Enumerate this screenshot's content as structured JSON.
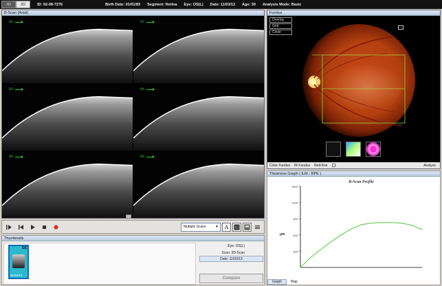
{
  "topbar": {
    "view_tabs": [
      "3D",
      "2D"
    ],
    "id": "ID: 92-08-7276",
    "birth_date": "Birth Date: 01/01/83",
    "segment": "Segment: Retina",
    "eye": "Eye: OS(L)",
    "date": "Date: 11/03/13",
    "age": "Age: 30",
    "analysis_mode": "Analysis Mode: Basic"
  },
  "bscan": {
    "title": "B-Scan (Axial)",
    "labels": [
      "01",
      "02",
      "03",
      "04",
      "05",
      "06"
    ],
    "controls": {
      "view_mode": "Multiple Scans",
      "font_button": "A"
    }
  },
  "thumbnails": {
    "title": "Thumbnails",
    "items": [
      {
        "label": "OS",
        "date": "11/03/13"
      }
    ],
    "info": {
      "eye": "Eye: OS(L)",
      "scan": "Scan: 3D-Scan",
      "date": "Date: 11/03/13"
    },
    "compare_label": "Compare"
  },
  "fundus": {
    "title": "Fundus",
    "overlay_options": [
      "Overlay",
      "Grid",
      "Circle"
    ],
    "tabs": [
      "Color Fundus",
      "IR Fundus",
      "Red-free"
    ],
    "analyze_label": "Analyze"
  },
  "thickness": {
    "title": "Thickness Graph  ( ILM - RPE )",
    "tabs": [
      "Graph",
      "Map"
    ]
  },
  "chart_data": {
    "type": "line",
    "title": "B-Scan Profile",
    "ylabel": "μm",
    "xlabel": "",
    "y_ticks": [
      "1500",
      "1200",
      "900",
      "600",
      "300"
    ],
    "ylim": [
      0,
      1500
    ],
    "x": [
      0,
      1,
      2,
      3,
      4,
      5,
      6,
      7,
      8,
      9,
      10,
      11,
      12
    ],
    "series": [
      {
        "values": [
          0,
          180,
          330,
          470,
          600,
          710,
          790,
          820,
          830,
          830,
          820,
          780,
          700
        ],
        "color": "#6ccf5a"
      }
    ],
    "grid": false
  }
}
